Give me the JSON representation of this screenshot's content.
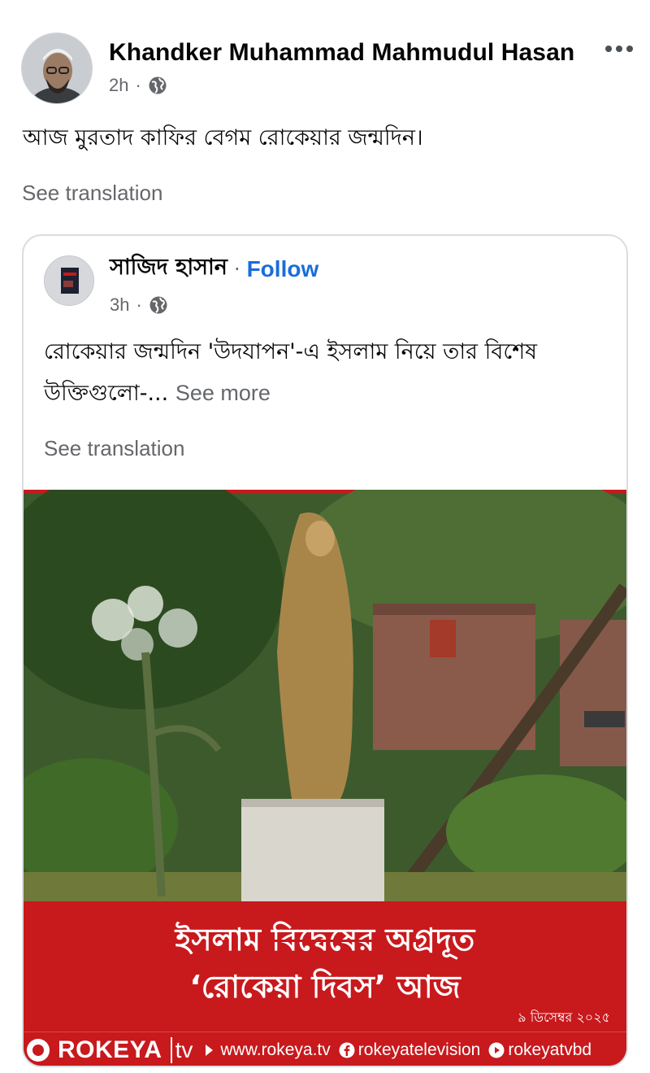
{
  "post": {
    "author": "Khandker Muhammad Mahmudul Hasan",
    "time": "2h",
    "sep": "·",
    "text": "আজ  মুরতাদ কাফির বেগম রোকেয়ার জন্মদিন।",
    "see_translation": "See translation"
  },
  "shared": {
    "author": "সাজিদ হাসান",
    "sep": "·",
    "follow": "Follow",
    "time": "3h",
    "text": "রোকেয়ার জন্মদিন 'উদযাপন'-এ ইসলাম নিয়ে তার বিশেষ উক্তিগুলো-...",
    "see_more": "See more",
    "see_translation": "See translation"
  },
  "image": {
    "headline_part1": "ইসলাম",
    "headline_struck": "বিদ্বেষের",
    "headline_part2": "অগ্রদূত",
    "headline_line2": "‘রোকেয়া দিবস’ আজ",
    "date": "৯ ডিসেম্বর ২০২৫",
    "brand": "ROKEYA",
    "brand_tv": "tv",
    "website": "www.rokeya.tv",
    "facebook": "rokeyatelevision",
    "youtube": "rokeyatvbd"
  },
  "colors": {
    "brand_red": "#c8191d",
    "link_blue": "#1a6ed8",
    "secondary_text": "#65676b"
  },
  "icons": {
    "globe": "globe-icon",
    "more": "more-dots-icon",
    "facebook": "facebook-icon",
    "youtube": "youtube-icon",
    "play": "play-arrow-icon"
  }
}
